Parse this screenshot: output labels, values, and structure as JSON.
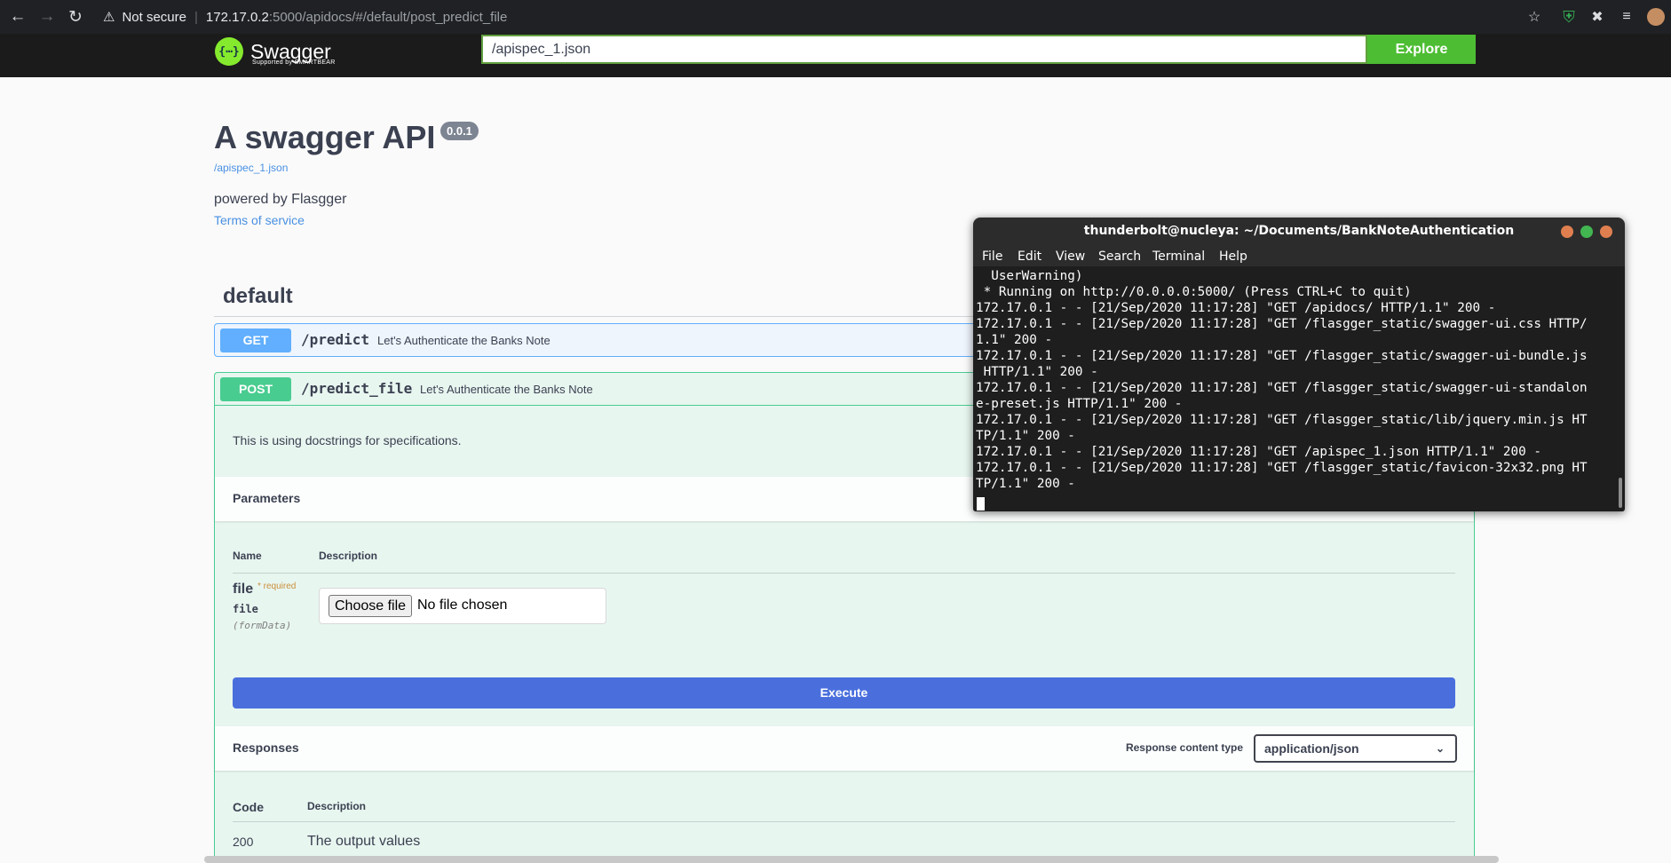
{
  "browser": {
    "not_secure": "Not secure",
    "url_host": "172.17.0.2",
    "url_path": ":5000/apidocs/#/default/post_predict_file"
  },
  "swagger_bar": {
    "logo_text": "Swagger",
    "logo_sub": "Supported by SMARTBEAR",
    "spec_url": "/apispec_1.json",
    "explore_label": "Explore"
  },
  "info": {
    "title": "A swagger API",
    "version": "0.0.1",
    "spec_link": "/apispec_1.json",
    "description": "powered by Flasgger",
    "terms": "Terms of service"
  },
  "tag": {
    "name": "default"
  },
  "operations": [
    {
      "method": "GET",
      "path": "/predict",
      "summary": "Let's Authenticate the Banks Note"
    },
    {
      "method": "POST",
      "path": "/predict_file",
      "summary": "Let's Authenticate the Banks Note"
    }
  ],
  "post_detail": {
    "description": "This is using docstrings for specifications.",
    "parameters_label": "Parameters",
    "col_name": "Name",
    "col_description": "Description",
    "param": {
      "name": "file",
      "required": "* required",
      "type": "file",
      "in": "(formData)"
    },
    "choose_file": "Choose file",
    "no_file": "No file chosen",
    "execute": "Execute",
    "responses_label": "Responses",
    "response_content_type_label": "Response content type",
    "response_content_type": "application/json",
    "col_code": "Code",
    "col_resp_description": "Description",
    "response": {
      "code": "200",
      "description": "The output values"
    }
  },
  "terminal": {
    "title": "thunderbolt@nucleya: ~/Documents/BankNoteAuthentication",
    "menu": [
      "File",
      "Edit",
      "View",
      "Search",
      "Terminal",
      "Help"
    ],
    "lines": [
      "  UserWarning)",
      " * Running on http://0.0.0.0:5000/ (Press CTRL+C to quit)",
      "172.17.0.1 - - [21/Sep/2020 11:17:28] \"GET /apidocs/ HTTP/1.1\" 200 -",
      "172.17.0.1 - - [21/Sep/2020 11:17:28] \"GET /flasgger_static/swagger-ui.css HTTP/",
      "1.1\" 200 -",
      "172.17.0.1 - - [21/Sep/2020 11:17:28] \"GET /flasgger_static/swagger-ui-bundle.js",
      " HTTP/1.1\" 200 -",
      "172.17.0.1 - - [21/Sep/2020 11:17:28] \"GET /flasgger_static/swagger-ui-standalon",
      "e-preset.js HTTP/1.1\" 200 -",
      "172.17.0.1 - - [21/Sep/2020 11:17:28] \"GET /flasgger_static/lib/jquery.min.js HT",
      "TP/1.1\" 200 -",
      "172.17.0.1 - - [21/Sep/2020 11:17:28] \"GET /apispec_1.json HTTP/1.1\" 200 -",
      "172.17.0.1 - - [21/Sep/2020 11:17:28] \"GET /flasgger_static/favicon-32x32.png HT",
      "TP/1.1\" 200 -"
    ]
  },
  "colors": {
    "get": "#61affe",
    "post": "#49cc90",
    "execute": "#4a6fdd",
    "explore": "#4dbd33"
  }
}
